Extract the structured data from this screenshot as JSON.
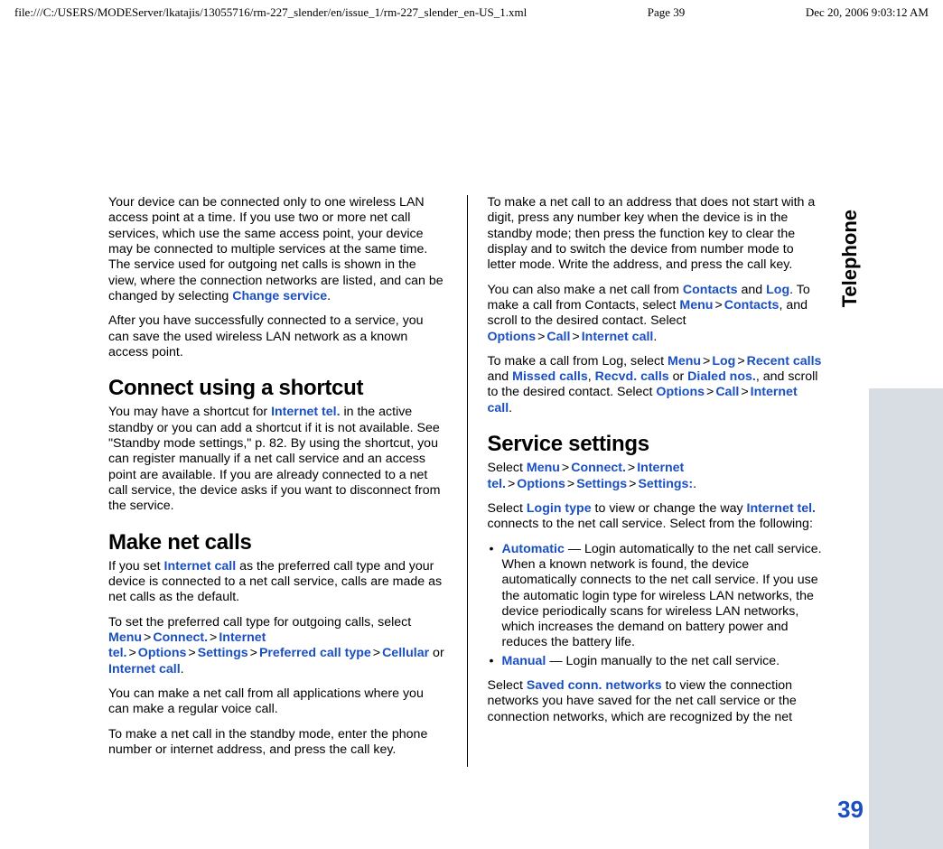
{
  "header": {
    "path": "file:///C:/USERS/MODEServer/lkatajis/13055716/rm-227_slender/en/issue_1/rm-227_slender_en-US_1.xml",
    "page": "Page 39",
    "datetime": "Dec 20, 2006 9:03:12 AM"
  },
  "side_tab": "Telephone",
  "page_number": "39",
  "left": {
    "p1a": "Your device can be connected only to one wireless LAN access point at a time. If you use two or more net call services, which use the same access point, your device may be connected to multiple services at the same time. The service used for outgoing net calls is shown in the view, where the connection networks are listed, and can be changed by selecting ",
    "p1b": "Change service",
    "p1c": ".",
    "p2": "After you have successfully connected to a service, you can save the used wireless LAN network as a known access point.",
    "h1": "Connect using a shortcut",
    "p3a": "You may have a shortcut for ",
    "p3b": "Internet tel.",
    "p3c": " in the active standby or you can add a shortcut if it is not available. See \"Standby mode settings,\" p. 82. By using the shortcut, you can register manually if a net call service and an access point are available. If you are already connected to a net call service, the device asks if you want to disconnect from the service.",
    "h2": "Make net calls",
    "p4a": "If you set ",
    "p4b": "Internet call",
    "p4c": " as the preferred call type and your device is connected to a net call service, calls are made as net calls as the default.",
    "p5a": "To set the preferred call type for outgoing calls, select ",
    "nav1": [
      "Menu",
      "Connect.",
      "Internet tel.",
      "Options",
      "Settings",
      "Preferred call type",
      "Cellular"
    ],
    "p5b": " or ",
    "p5c": "Internet call",
    "p5d": ".",
    "p6": "You can make a net call from all applications where you can make a regular voice call.",
    "p7": "To make a net call in the standby mode, enter the phone number or internet address, and press the call key."
  },
  "right": {
    "p1": "To make a net call to an address that does not start with a digit, press any number key when the device is in the standby mode; then press the function key to clear the display and to switch the device from number mode to letter mode. Write the address, and press the call key.",
    "p2a": "You can also make a net call from ",
    "p2b": "Contacts",
    "p2c": " and ",
    "p2d": "Log",
    "p2e": ". To make a call from Contacts, select ",
    "nav2": [
      "Menu",
      "Contacts"
    ],
    "p2f": ", and scroll to the desired contact. Select ",
    "nav3": [
      "Options",
      "Call",
      "Internet call"
    ],
    "p2g": ".",
    "p3a": "To make a call from Log, select ",
    "nav4": [
      "Menu",
      "Log",
      "Recent calls"
    ],
    "p3b": " and ",
    "p3c": "Missed calls",
    "p3d": ", ",
    "p3e": "Recvd. calls",
    "p3f": " or ",
    "p3g": "Dialed nos.",
    "p3h": ", and scroll to the desired contact. Select ",
    "nav5": [
      "Options",
      "Call",
      "Internet call"
    ],
    "p3i": ".",
    "h1": "Service settings",
    "p4a": "Select ",
    "nav6": [
      "Menu",
      "Connect.",
      "Internet tel.",
      "Options",
      "Settings",
      "Settings:"
    ],
    "p4b": ".",
    "p5a": "Select ",
    "p5b": "Login type",
    "p5c": " to view or change the way ",
    "p5d": "Internet tel.",
    "p5e": " connects to the net call service. Select from the following:",
    "b1a": "Automatic",
    "b1b": " — Login automatically to the net call service. When a known network is found, the device automatically connects to the net call service. If you use the automatic login type for wireless LAN networks, the device periodically scans for wireless LAN networks, which increases the demand on battery power and reduces the battery life.",
    "b2a": "Manual",
    "b2b": " —  Login manually to the net call service.",
    "p6a": "Select ",
    "p6b": "Saved conn. networks",
    "p6c": " to view the connection networks you have saved for the net call service or the connection networks, which are recognized by the net"
  },
  "gt": ">"
}
